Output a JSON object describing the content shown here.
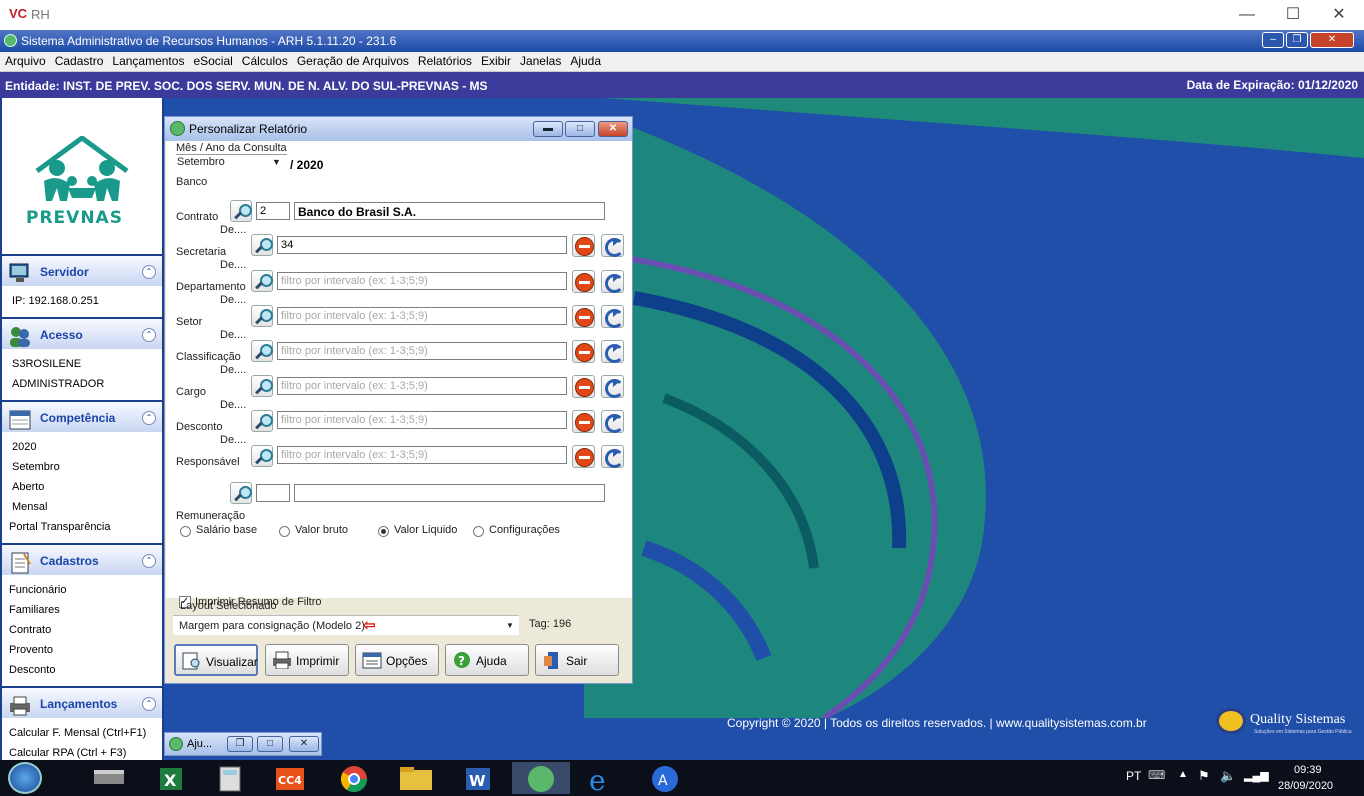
{
  "outer_window": {
    "title": "RH",
    "logo": "VC",
    "controls": [
      "minimize-icon",
      "maximize-icon",
      "close-icon"
    ]
  },
  "app": {
    "title": "Sistema Administrativo de Recursos Humanos - ARH 5.1.11.20 - 231.6",
    "menu": [
      "Arquivo",
      "Cadastro",
      "Lançamentos",
      "eSocial",
      "Cálculos",
      "Geração de Arquivos",
      "Relatórios",
      "Exibir",
      "Janelas",
      "Ajuda"
    ],
    "entity": "Entidade: INST. DE PREV. SOC. DOS SERV. MUN. DE N. ALV. DO SUL-PREVNAS - MS",
    "expiry": "Data de Expiração: 01/12/2020"
  },
  "sidebar": {
    "logo_text": "PREVNAS",
    "servidor": {
      "title": "Servidor",
      "ip": "IP: 192.168.0.251"
    },
    "acesso": {
      "title": "Acesso",
      "user": "S3ROSILENE",
      "role": "ADMINISTRADOR"
    },
    "competencia": {
      "title": "Competência",
      "year": "2020",
      "month": "Setembro",
      "status": "Aberto",
      "type": "Mensal",
      "portal": "Portal Transparência"
    },
    "cadastros": {
      "title": "Cadastros",
      "items": [
        "Funcionário",
        "Familiares",
        "Contrato",
        "Provento",
        "Desconto"
      ]
    },
    "lancamentos": {
      "title": "Lançamentos",
      "items": [
        "Calcular F. Mensal (Ctrl+F1)",
        "Calcular RPA (Ctrl + F3)"
      ]
    }
  },
  "dialog": {
    "title": "Personalizar Relatório",
    "mes_ano_label": "Mês / Ano da Consulta",
    "month": "Setembro",
    "year": "/ 2020",
    "banco": {
      "label": "Banco",
      "code": "2",
      "name": "Banco do Brasil S.A."
    },
    "de_label": "De....",
    "contrato": {
      "label": "Contrato",
      "value": "34"
    },
    "filters": [
      {
        "label": "Secretaria",
        "placeholder": "filtro por intervalo (ex: 1-3;5;9)"
      },
      {
        "label": "Departamento",
        "placeholder": "filtro por intervalo (ex: 1-3;5;9)"
      },
      {
        "label": "Setor",
        "placeholder": "filtro por intervalo (ex: 1-3;5;9)"
      },
      {
        "label": "Classificação",
        "placeholder": "filtro por intervalo (ex: 1-3;5;9)"
      },
      {
        "label": "Cargo",
        "placeholder": "filtro por intervalo (ex: 1-3;5;9)"
      },
      {
        "label": "Desconto",
        "placeholder": "filtro por intervalo (ex: 1-3;5;9)"
      }
    ],
    "responsavel": {
      "label": "Responsável",
      "code": "",
      "name": ""
    },
    "remuneracao": {
      "label": "Remuneração",
      "options": [
        "Salário base",
        "Valor bruto",
        "Valor Liquido",
        "Configurações"
      ],
      "selected": "Valor Liquido"
    },
    "imprimir_resumo": {
      "label": "Imprimir Resumo de Filtro",
      "checked": true
    },
    "layout": {
      "label": "Layout Selecionado",
      "value": "Margem para consignação (Modelo 2)",
      "tag": "Tag: 196"
    },
    "buttons": [
      "Visualizar",
      "Imprimir",
      "Opções",
      "Ajuda",
      "Sair"
    ]
  },
  "mini_window": {
    "title": "Aju..."
  },
  "footer": {
    "copyright": "Copyright © 2020  |  Todos os direitos reservados.  |  www.qualitysistemas.com.br",
    "brand": "Quality Sistemas",
    "brand_sub": "Soluções em Sistemas para Gestão Pública"
  },
  "taskbar": {
    "lang": "PT",
    "time": "09:39",
    "date": "28/09/2020"
  },
  "colors": {
    "app_bar": "#1d4aa6",
    "entity_bar": "#3c3a9a",
    "desktop": "#1f4fa8",
    "accent_green": "#1e8a7a"
  }
}
